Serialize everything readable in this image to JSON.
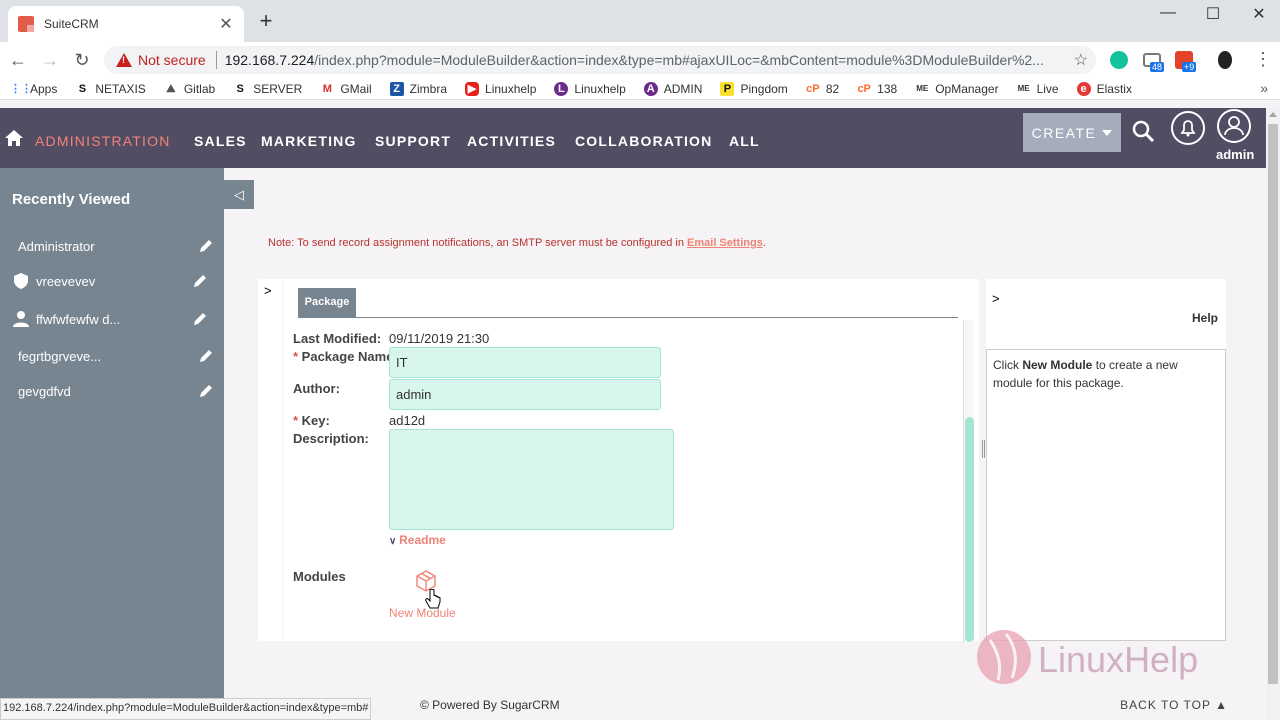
{
  "browser": {
    "tab_title": "SuiteCRM",
    "not_secure": "Not secure",
    "url_host": "192.168.7.224",
    "url_path": "/index.php?module=ModuleBuilder&action=index&type=mb#ajaxUILoc=&mbContent=module%3DModuleBuilder%2...",
    "ext_badge_1": "48",
    "ext_badge_2": "+9",
    "bookmarks": [
      "Apps",
      "NETAXIS",
      "Gitlab",
      "SERVER",
      "GMail",
      "Zimbra",
      "Linuxhelp",
      "Linuxhelp",
      "ADMIN",
      "Pingdom",
      "82",
      "138",
      "OpManager",
      "Live",
      "Elastix"
    ]
  },
  "nav": {
    "items": [
      "ADMINISTRATION",
      "SALES",
      "MARKETING",
      "SUPPORT",
      "ACTIVITIES",
      "COLLABORATION",
      "ALL"
    ],
    "create_label": "CREATE",
    "user_label": "admin"
  },
  "sidebar": {
    "heading": "Recently Viewed",
    "items": [
      "Administrator",
      "vreevevev",
      "ffwfwfewfw d...",
      "fegrtbgrveve...",
      "gevgdfvd"
    ]
  },
  "notice": {
    "text": "Note: To send record assignment notifications, an SMTP server must be configured in ",
    "link": "Email Settings",
    "suffix": "."
  },
  "package": {
    "tab": "Package",
    "last_modified_label": "Last Modified:",
    "last_modified_value": "09/11/2019 21:30",
    "name_label": "Package Name:",
    "name_value": "IT",
    "author_label": "Author:",
    "author_value": "admin",
    "key_label": "Key:",
    "key_value": "ad12d",
    "description_label": "Description:",
    "readme": "Readme",
    "modules_label": "Modules",
    "new_module": "New Module"
  },
  "help": {
    "title": "Help",
    "text_before": "Click ",
    "text_bold": "New Module",
    "text_after": " to create a new module for this package."
  },
  "footer": {
    "powered": "© Powered By SugarCRM",
    "back_to_top": "BACK TO TOP",
    "status_url": "192.168.7.224/index.php?module=ModuleBuilder&action=index&type=mb#"
  },
  "watermark": "LinuxHelp",
  "colors": {
    "nav_bg": "#534d64",
    "accent": "#f08377",
    "sidebar_bg": "#778591",
    "field_bg": "#d8f5ee"
  }
}
